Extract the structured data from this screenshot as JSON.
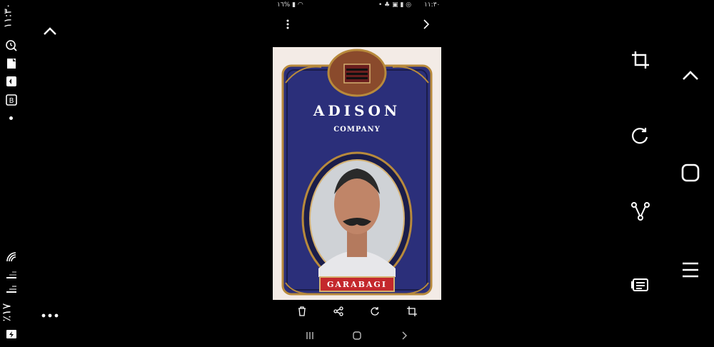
{
  "status_bar": {
    "time": "١١:٣٠",
    "battery_percent": "١٦%",
    "left_time_vertical": "١١:٣٠",
    "left_battery_vertical": "٪١٧"
  },
  "viewer": {
    "photo": {
      "brand": "ADISON",
      "subtitle": "COMPANY",
      "banner": "GARABAGI"
    }
  },
  "icons": {
    "left_up": "chevron-up-icon",
    "left_more": "more-horizontal-icon",
    "top_menu": "more-vertical-icon",
    "top_next": "chevron-right-icon",
    "right_crop": "crop-icon",
    "right_rotate": "rotate-icon",
    "right_share": "share-icon",
    "right_details": "details-icon",
    "nav_up": "chevron-up-icon",
    "nav_home": "home-icon",
    "nav_menu": "menu-icon",
    "tool_delete": "trash-icon",
    "tool_share": "share-icon",
    "tool_rotate": "rotate-icon",
    "tool_crop": "crop-icon",
    "sys_recent": "recent-apps-icon",
    "sys_home": "home-icon",
    "sys_back": "back-icon"
  },
  "colors": {
    "background": "#000000",
    "card_blue": "#2b2f7a",
    "banner_red": "#c4282c",
    "gold": "#b88a3c"
  }
}
